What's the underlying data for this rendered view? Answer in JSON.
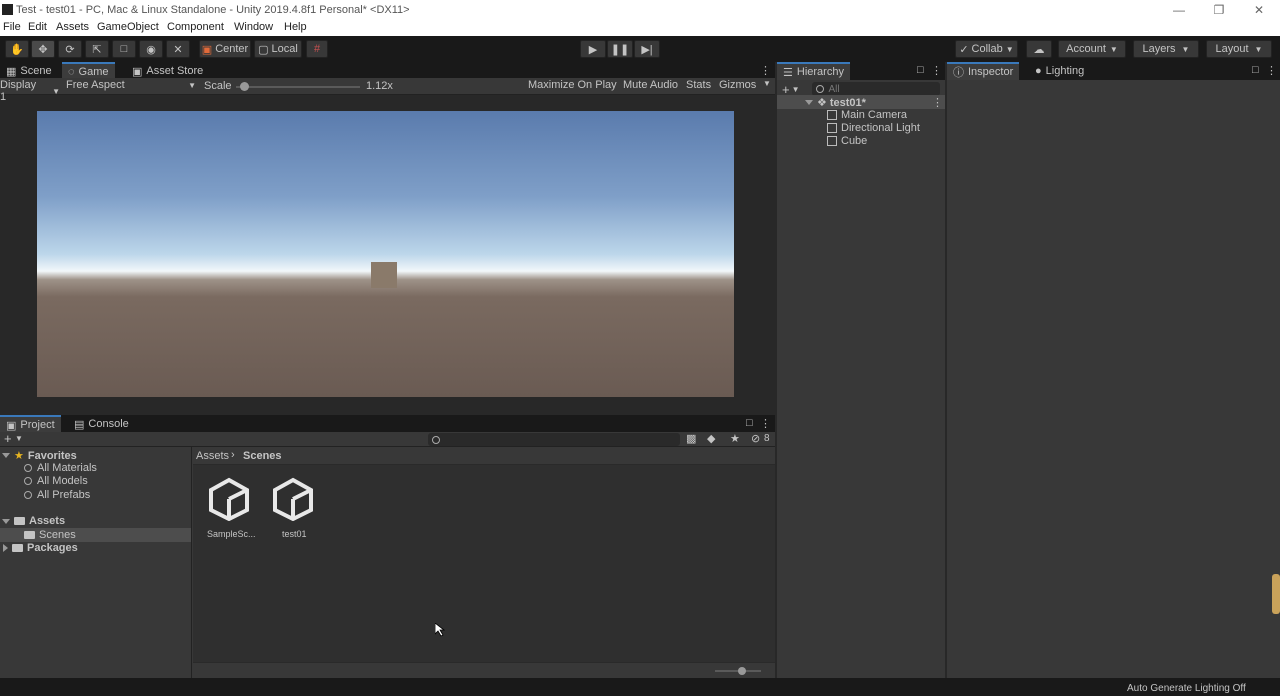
{
  "window": {
    "title": "Test - test01 - PC, Mac & Linux Standalone - Unity 2019.4.8f1 Personal* <DX11>"
  },
  "menu": [
    "File",
    "Edit",
    "Assets",
    "GameObject",
    "Component",
    "Window",
    "Help"
  ],
  "toolbar": {
    "center_label": "Center",
    "local_label": "Local",
    "collab_label": "Collab",
    "account_label": "Account",
    "layers_label": "Layers",
    "layout_label": "Layout"
  },
  "game_panel": {
    "tabs": [
      "Scene",
      "Game",
      "Asset Store"
    ],
    "active_tab": "Game",
    "display": "Display 1",
    "aspect": "Free Aspect",
    "scale_label": "Scale",
    "scale_value": "1.12x",
    "scale_fraction": 0.03,
    "buttons": [
      "Maximize On Play",
      "Mute Audio",
      "Stats",
      "Gizmos"
    ]
  },
  "hierarchy": {
    "title": "Hierarchy",
    "search_placeholder": "All",
    "scene": "test01*",
    "objects": [
      "Main Camera",
      "Directional Light",
      "Cube"
    ]
  },
  "inspector": {
    "tabs": [
      "Inspector",
      "Lighting"
    ]
  },
  "project": {
    "tabs": [
      "Project",
      "Console"
    ],
    "favorites_label": "Favorites",
    "favorites": [
      "All Materials",
      "All Models",
      "All Prefabs"
    ],
    "assets_label": "Assets",
    "scenes_label": "Scenes",
    "packages_label": "Packages",
    "breadcrumb": [
      "Assets",
      "Scenes"
    ],
    "files": [
      "SampleSc...",
      "test01"
    ],
    "hidden_count": "8"
  },
  "status": {
    "message": "Auto Generate Lighting Off"
  },
  "colors": {
    "accent": "#3a79bb",
    "panel": "#383838",
    "dark": "#191919",
    "selection": "#4d4d4d"
  }
}
